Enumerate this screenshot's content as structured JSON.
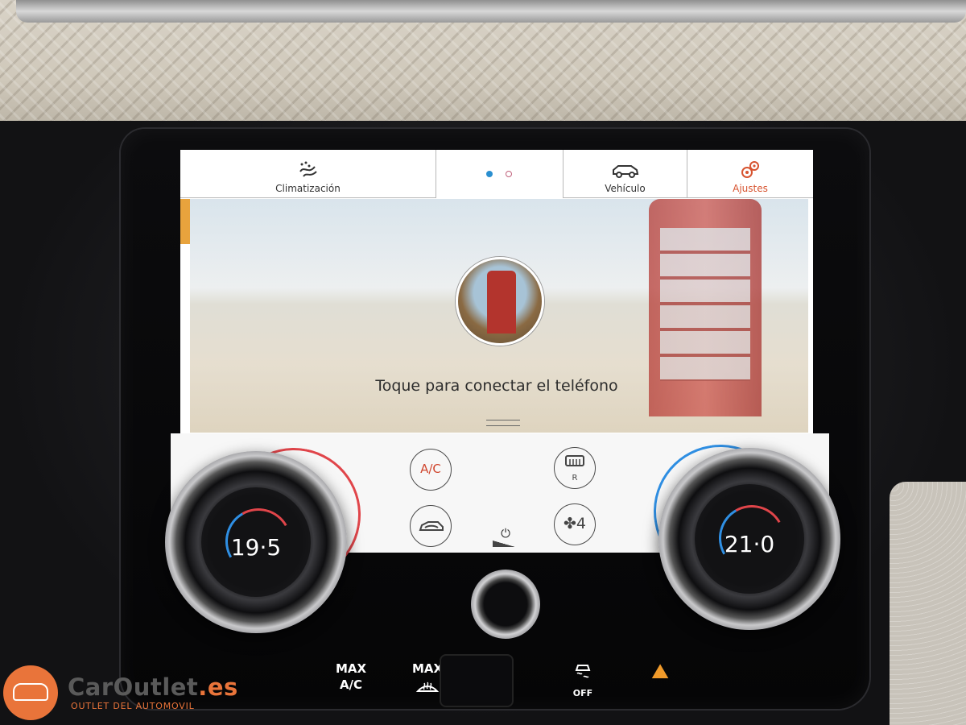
{
  "tabs": {
    "climatizacion": "Climatización",
    "vehiculo": "Vehículo",
    "ajustes": "Ajustes"
  },
  "main": {
    "connect_prompt": "Toque para conectar el teléfono"
  },
  "climate": {
    "ac_label": "A/C",
    "rear_defrost_label": "R",
    "fan_speed": "4",
    "temp_left": "19·5",
    "temp_right": "21·0"
  },
  "hardware": {
    "max_ac_line1": "MAX",
    "max_ac_line2": "A/C",
    "max_defrost_line1": "MAX",
    "traction_off": "OFF"
  },
  "watermark": {
    "brand_main": "CarOutlet",
    "brand_tld": ".es",
    "tagline": "OUTLET DEL AUTOMOVIL"
  },
  "colors": {
    "accent_orange": "#e8a33d",
    "settings_red": "#d7532f",
    "page_dot_active": "#2a8fd0",
    "temp_hot": "#e0454a",
    "temp_cold": "#2f8fe3",
    "brand_orange": "#e9743a"
  },
  "icons": {
    "climate": "fan-airflow-icon",
    "vehicle": "car-side-icon",
    "settings": "gears-icon",
    "recirculation": "car-recirculation-icon",
    "rear_defrost": "rear-defrost-icon",
    "fan": "fan-icon",
    "power": "power-icon",
    "traction": "traction-control-icon",
    "terrain": "terrain-response-icon"
  }
}
